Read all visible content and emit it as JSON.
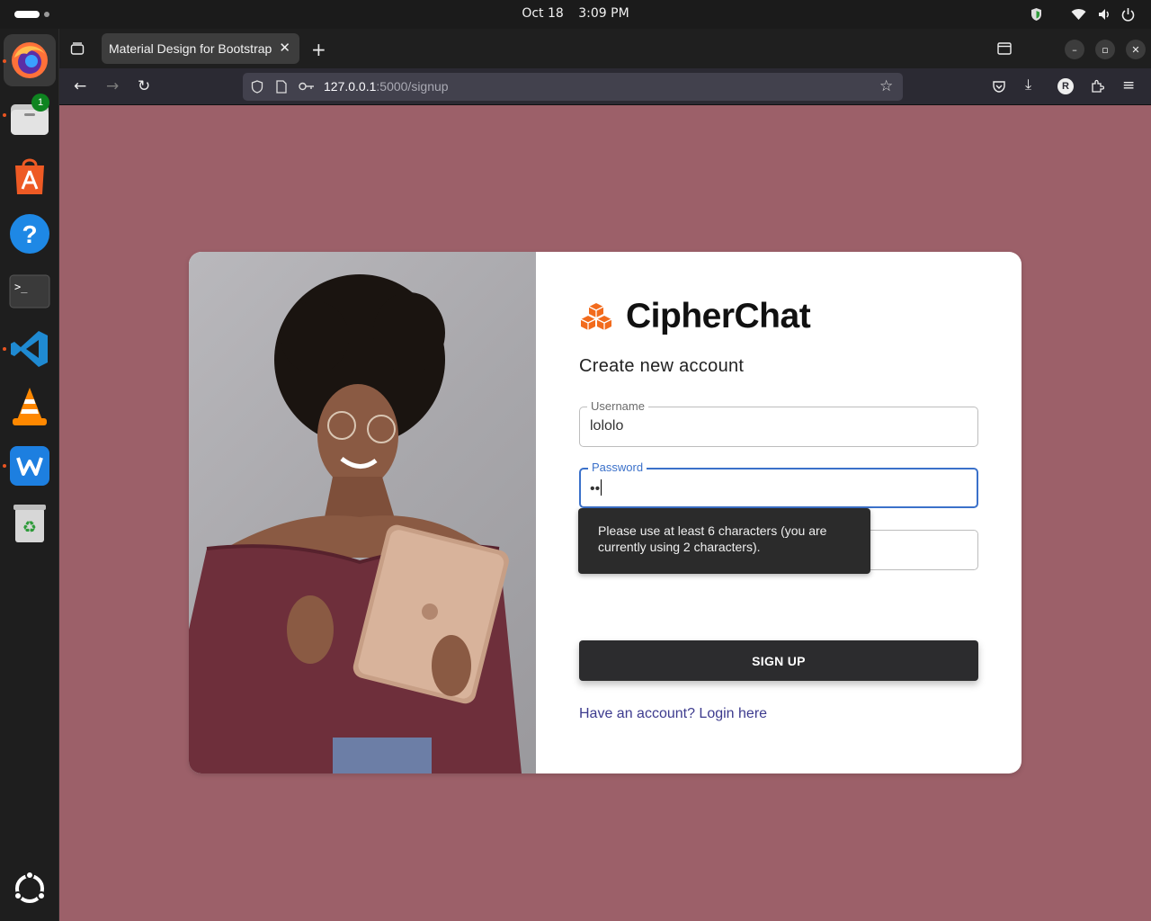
{
  "system": {
    "date": "Oct 18",
    "time": "3:09 PM"
  },
  "dock": {
    "files_badge": "1"
  },
  "browser": {
    "tab_title": "Material Design for Bootstrap",
    "url_host": "127.0.0.1",
    "url_path": ":5000/signup",
    "account_initial": "R"
  },
  "page": {
    "brand_name": "CipherChat",
    "brand_color": "#f26b1d",
    "subtitle": "Create new account",
    "username_label": "Username",
    "username_value": "lololo",
    "password_label": "Password",
    "password_value": "••",
    "tooltip": "Please use at least 6 characters (you are currently using 2 characters).",
    "signup_label": "SIGN UP",
    "login_link": "Have an account? Login here",
    "background_color": "#9c6069"
  }
}
